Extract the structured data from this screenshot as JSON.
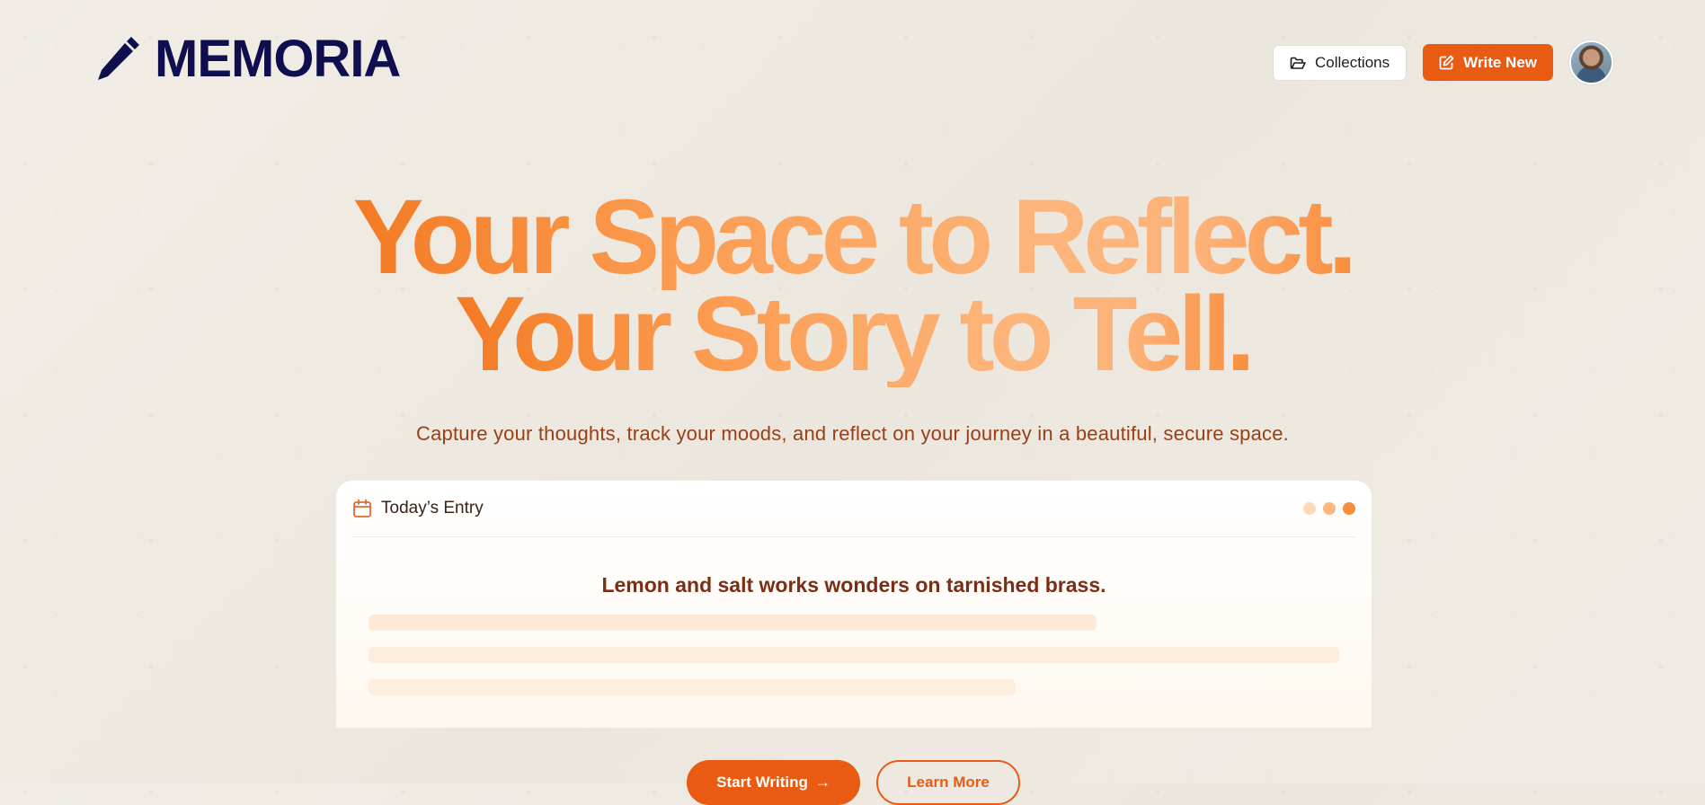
{
  "brand": {
    "name": "MEMORIA",
    "icon": "pencil-icon",
    "color": "#0f0f4f"
  },
  "nav": {
    "collections_label": "Collections",
    "collections_icon": "folder-icon",
    "write_label": "Write New",
    "write_icon": "edit-icon",
    "avatar": "user-avatar"
  },
  "hero": {
    "line1": "Your Space to Reflect.",
    "line2": "Your Story to Tell.",
    "subtitle": "Capture your thoughts, track your moods, and reflect on your journey in a beautiful, secure space."
  },
  "entry_card": {
    "icon": "calendar-icon",
    "title": "Today’s Entry",
    "quote": "Lemon and salt works wonders on tarnished brass.",
    "dot_colors": [
      "#fdd9b8",
      "#fbb77e",
      "#f58f3c"
    ]
  },
  "cta": {
    "start_label": "Start Writing",
    "start_icon": "arrow-right-icon",
    "learn_label": "Learn More"
  },
  "colors": {
    "accent": "#e95b13",
    "text_brown": "#9a3e14"
  }
}
